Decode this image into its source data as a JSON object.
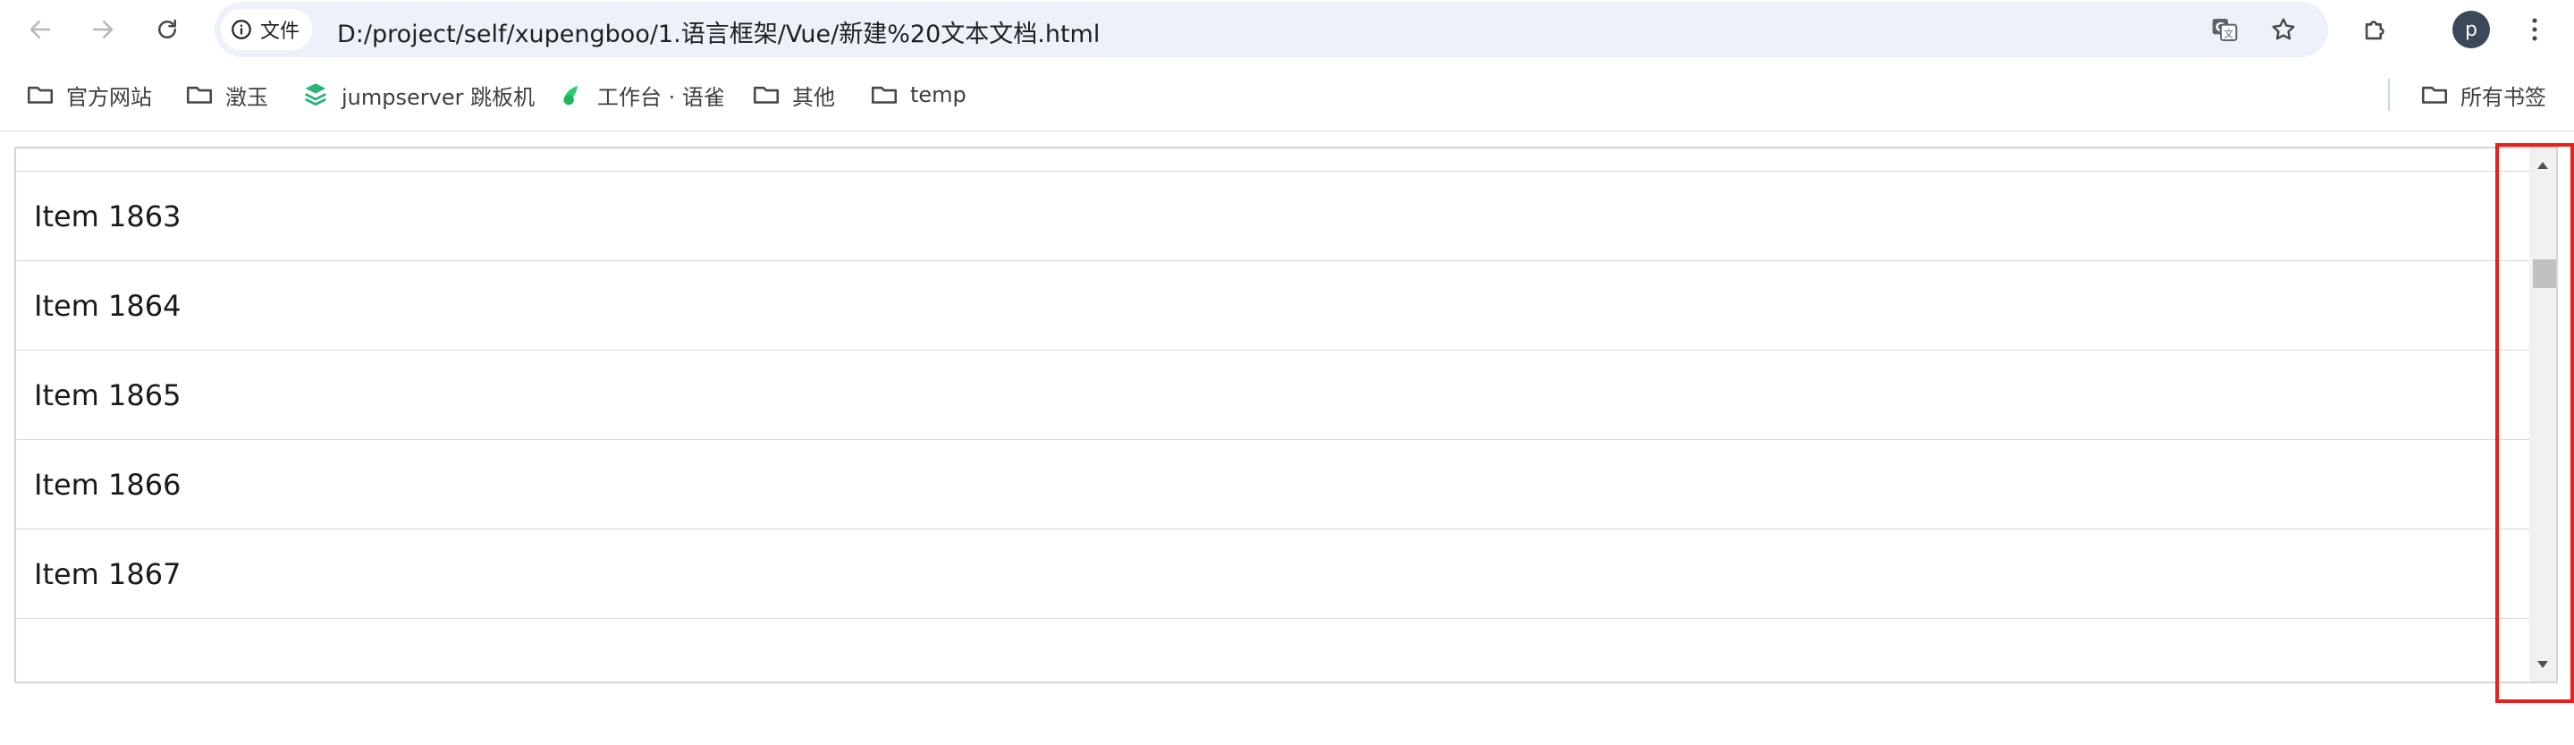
{
  "browser": {
    "back_icon": "arrow-left-icon",
    "forward_icon": "arrow-right-icon",
    "reload_icon": "reload-icon",
    "site_info": {
      "icon": "info-icon",
      "label": "文件"
    },
    "url": "D:/project/self/xupengboo/1.语言框架/Vue/新建%20文本文档.html",
    "translate_icon": "translate-icon",
    "bookmark_star_icon": "star-icon",
    "extensions_icon": "puzzle-icon",
    "profile_initial": "p",
    "menu_icon": "more-vertical-icon"
  },
  "bookmarks_bar": {
    "items": [
      {
        "label": "官方网站",
        "icon": "folder-icon"
      },
      {
        "label": "澂玉",
        "icon": "folder-icon"
      },
      {
        "label": "jumpserver 跳板机",
        "icon": "jumpserver-icon"
      },
      {
        "label": "工作台 · 语雀",
        "icon": "yuque-icon"
      },
      {
        "label": "其他",
        "icon": "folder-icon"
      },
      {
        "label": "temp",
        "icon": "folder-icon"
      }
    ],
    "all_bookmarks": {
      "label": "所有书签",
      "icon": "folder-icon"
    }
  },
  "list": {
    "items": [
      {
        "label": "Item 1863"
      },
      {
        "label": "Item 1864"
      },
      {
        "label": "Item 1865"
      },
      {
        "label": "Item 1866"
      },
      {
        "label": "Item 1867"
      }
    ],
    "scroll_position": 0.05
  },
  "colors": {
    "highlight": "#e8211a",
    "omnibox_bg": "#edf2fa",
    "avatar_bg": "#3c4858",
    "scroll_track": "#f1f1f1",
    "scroll_thumb": "#c1c1c1"
  }
}
